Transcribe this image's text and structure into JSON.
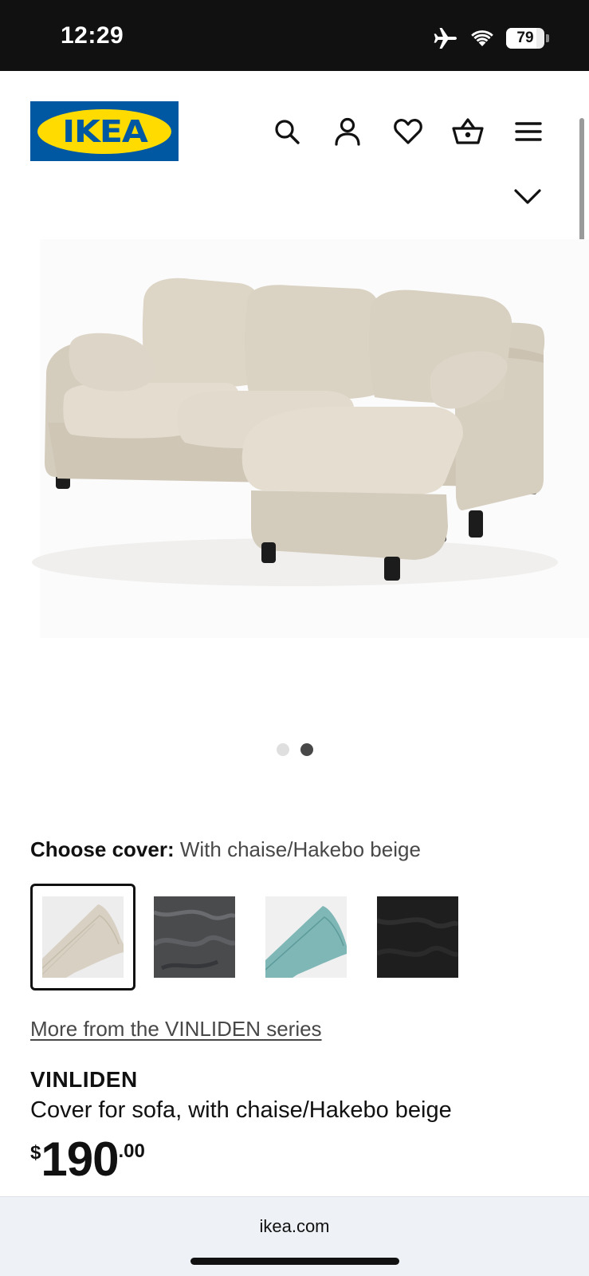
{
  "status_bar": {
    "time": "12:29",
    "battery": "79",
    "battery_level_percent": 79,
    "icons": [
      "airplane-icon",
      "wifi-icon",
      "battery-icon"
    ]
  },
  "header": {
    "logo_text": "IKEA",
    "brand_colors": {
      "blue": "#0058a3",
      "yellow": "#ffdb00"
    },
    "icons": [
      "search-icon",
      "account-icon",
      "heart-icon",
      "basket-icon",
      "menu-icon"
    ]
  },
  "gallery": {
    "image_count": 2,
    "active_index": 2
  },
  "cover": {
    "label": "Choose cover:",
    "value": "With chaise/Hakebo beige",
    "swatches": [
      {
        "name": "Hakebo beige",
        "color": "#d8d0c2",
        "selected": true
      },
      {
        "name": "dark gray",
        "color": "#4a4b4d",
        "selected": false
      },
      {
        "name": "turquoise",
        "color": "#7fb6b6",
        "selected": false
      },
      {
        "name": "black",
        "color": "#1e1e1e",
        "selected": false
      }
    ]
  },
  "series_link": "More from the VINLIDEN series",
  "product": {
    "name": "VINLIDEN",
    "description": "Cover for sofa, with chaise/Hakebo beige",
    "price": {
      "currency": "$",
      "integer": "190",
      "decimal": ".00"
    }
  },
  "browser": {
    "url": "ikea.com"
  }
}
